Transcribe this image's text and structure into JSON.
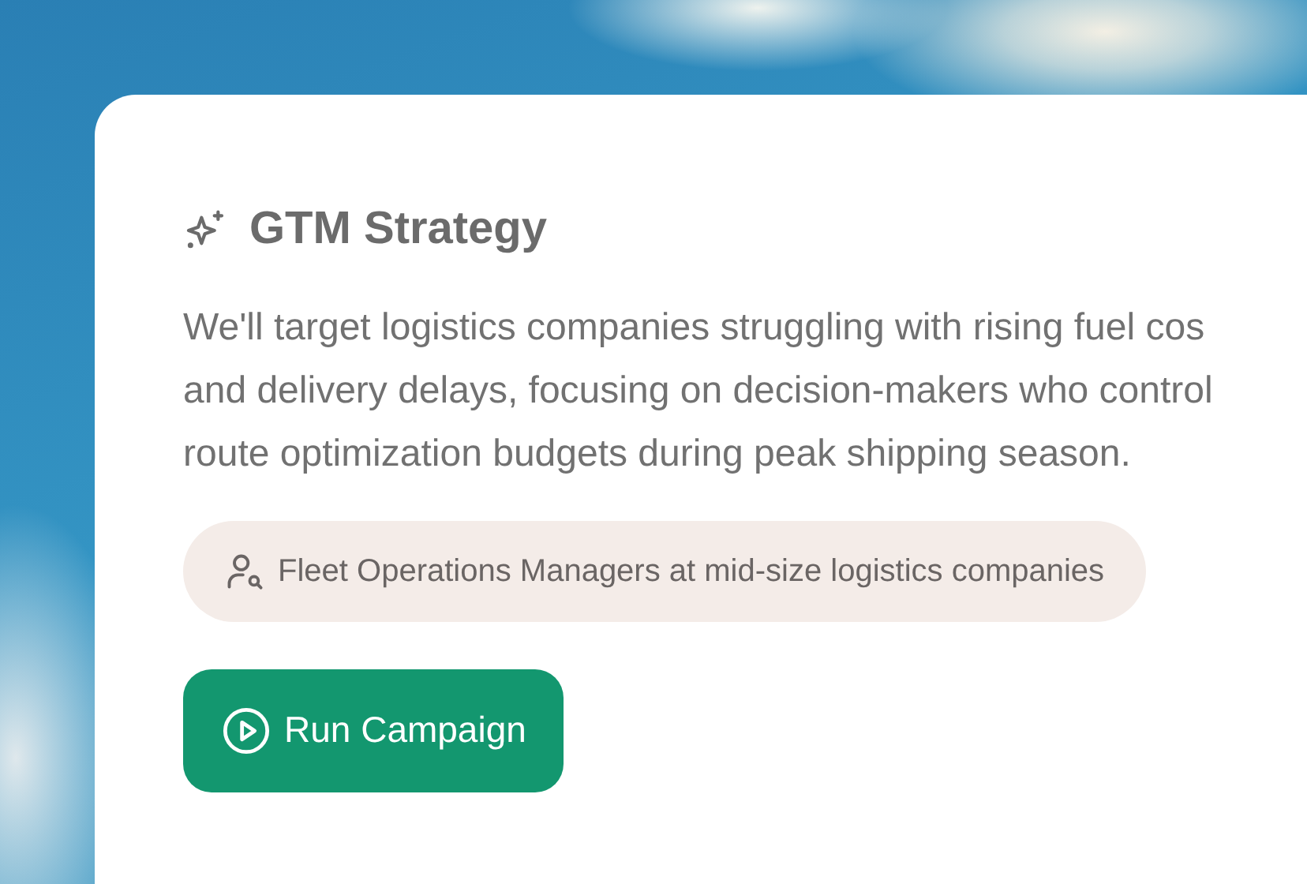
{
  "card": {
    "title": "GTM Strategy",
    "description_lines": [
      "We'll target logistics companies struggling with rising fuel cos",
      "and delivery delays, focusing on decision-makers who control",
      "route optimization budgets during peak shipping season."
    ],
    "audience": "Fleet Operations Managers at mid-size logistics companies",
    "button": "Run Campaign"
  }
}
